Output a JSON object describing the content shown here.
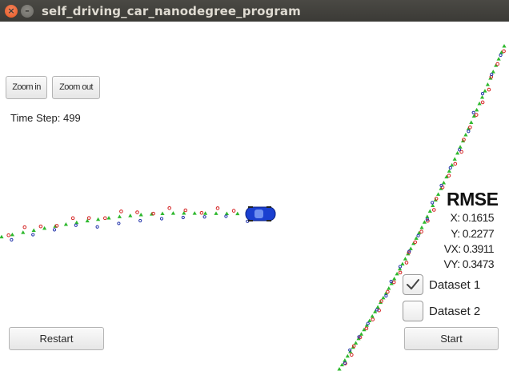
{
  "window": {
    "title": "self_driving_car_nanodegree_program"
  },
  "controls": {
    "zoom_in": "Zoom in",
    "zoom_out": "Zoom out",
    "restart": "Restart",
    "start": "Start"
  },
  "status": {
    "time_step": "Time Step: 499"
  },
  "rmse": {
    "title": "RMSE",
    "x": "X: 0.1615",
    "y": "Y: 0.2277",
    "vx": "VX: 0.3911",
    "vy": "VY: 0.3473"
  },
  "datasets": [
    {
      "label": "Dataset 1",
      "checked": true
    },
    {
      "label": "Dataset 2",
      "checked": false
    }
  ],
  "colors": {
    "estimate": "#2eb82e",
    "lidar": "#d42020",
    "radar": "#2233aa",
    "car": "#1a3fd0"
  },
  "icons": {
    "close": "close-icon",
    "minimize": "minimize-icon",
    "car": "car-icon",
    "check": "checkmark-icon"
  }
}
